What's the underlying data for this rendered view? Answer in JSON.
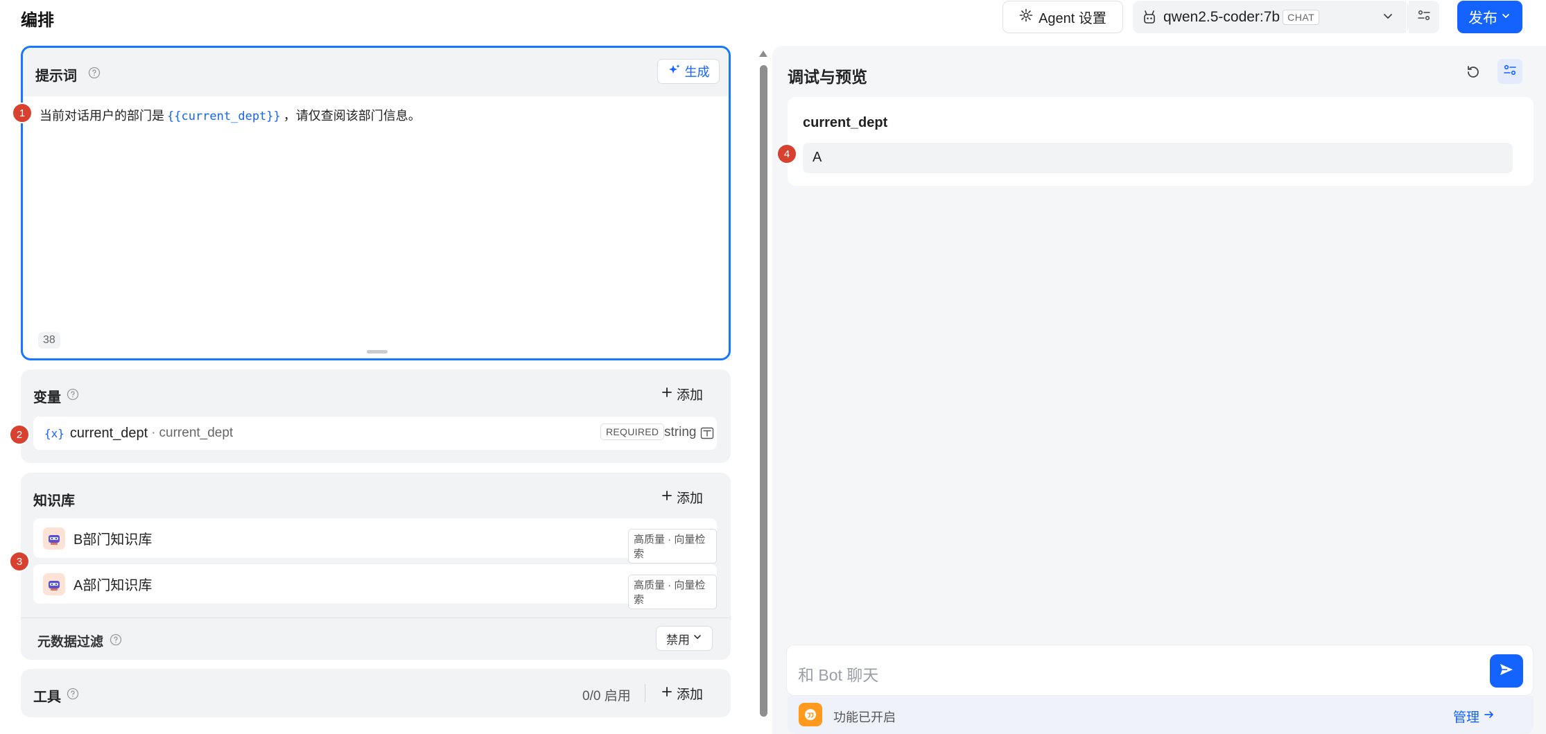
{
  "header": {
    "title": "编排",
    "agent_settings_label": "Agent 设置",
    "model_name": "qwen2.5-coder:7b",
    "model_badge": "CHAT",
    "publish_label": "发布"
  },
  "prompt": {
    "title": "提示词",
    "generate_label": "生成",
    "text_before": "当前对话用户的部门是",
    "variable_token": "{{current_dept}}",
    "text_after": "，请仅查阅该部门信息。",
    "char_count": "38"
  },
  "variables": {
    "title": "变量",
    "add_label": "添加",
    "items": [
      {
        "icon_text": "{x}",
        "name": "current_dept",
        "separator": "·",
        "key": "current_dept",
        "required_label": "REQUIRED",
        "type": "string"
      }
    ]
  },
  "knowledge": {
    "title": "知识库",
    "add_label": "添加",
    "items": [
      {
        "name": "B部门知识库",
        "badge": "高质量 · 向量检索"
      },
      {
        "name": "A部门知识库",
        "badge": "高质量 · 向量检索"
      }
    ],
    "metadata_filter_title": "元数据过滤",
    "metadata_filter_value": "禁用"
  },
  "tools": {
    "title": "工具",
    "count": "0/0 启用",
    "add_label": "添加"
  },
  "preview": {
    "title": "调试与预览",
    "variable_label": "current_dept",
    "variable_value": "A",
    "chat_placeholder": "和 Bot 聊天",
    "feature_text": "功能已开启",
    "manage_label": "管理"
  },
  "markers": [
    "1",
    "2",
    "3",
    "4"
  ],
  "colors": {
    "accent": "#1463ff",
    "focus_border": "#1677ff",
    "marker": "#d8412f",
    "panel_bg": "#f2f3f5"
  },
  "icons": [
    "gear-icon",
    "robot-icon",
    "chevron-down-icon",
    "settings-sliders-icon",
    "help-icon",
    "sparkle-icon",
    "plus-icon",
    "variable-icon",
    "edit-field-icon",
    "knowledge-base-icon",
    "refresh-icon",
    "send-icon",
    "quote-icon",
    "arrow-right-icon"
  ]
}
